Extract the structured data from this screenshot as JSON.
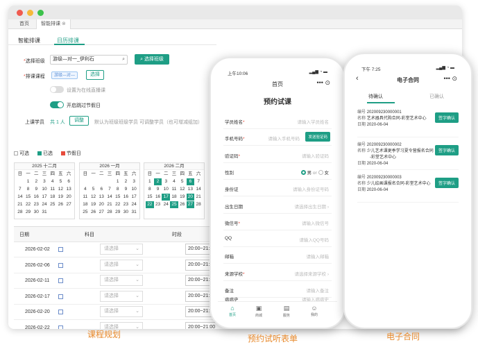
{
  "window": {
    "tabs": [
      "首页",
      "智能排课"
    ],
    "tab_close": "⊗",
    "subtabs": [
      "智能排课",
      "日历排课"
    ]
  },
  "form": {
    "class_label": "选择班级",
    "class_value": "游级—对一_伊利石",
    "class_btn": "选择班级",
    "course_label": "排课课程",
    "course_tag": "游级—对—",
    "course_btn": "选择",
    "toggle1": "设置为在线直播课",
    "toggle2": "开启跳过节假日",
    "students_label": "上课学员",
    "students_count": "共 1 人",
    "students_btn": "调整",
    "students_note": "默认为班级班级学员  可调整学员（也可增减组加）"
  },
  "legend": {
    "free": "可选",
    "selected": "已选",
    "holiday": "节假日"
  },
  "colors": {
    "accent": "#1e9e85",
    "caption": "#e8892b",
    "holiday": "#e74c3c"
  },
  "calendars": [
    {
      "title": "2025 十二月",
      "weekdays": [
        "日",
        "一",
        "二",
        "三",
        "四",
        "五",
        "六"
      ],
      "cells": [
        "",
        "1",
        "2",
        "3",
        "4",
        "5",
        "6",
        "7",
        "8",
        "9",
        "10",
        "11",
        "12",
        "13",
        "14",
        "15",
        "16",
        "17",
        "18",
        "19",
        "20",
        "21",
        "22",
        "23",
        "24",
        "25",
        "26",
        "27",
        "28",
        "29",
        "30",
        "31",
        "",
        "",
        ""
      ],
      "highlighted": []
    },
    {
      "title": "2026 一月",
      "weekdays": [
        "日",
        "一",
        "二",
        "三",
        "四",
        "五",
        "六"
      ],
      "cells": [
        "",
        "",
        "",
        "",
        "1",
        "2",
        "3",
        "4",
        "5",
        "6",
        "7",
        "8",
        "9",
        "10",
        "11",
        "12",
        "13",
        "14",
        "15",
        "16",
        "17",
        "18",
        "19",
        "20",
        "21",
        "22",
        "23",
        "24",
        "25",
        "26",
        "27",
        "28",
        "29",
        "30",
        "31"
      ],
      "highlighted": []
    },
    {
      "title": "2026 二月",
      "weekdays": [
        "日",
        "一",
        "二",
        "三",
        "四",
        "五",
        "六"
      ],
      "cells": [
        "1",
        "2",
        "3",
        "4",
        "5",
        "6",
        "7",
        "8",
        "9",
        "10",
        "11",
        "12",
        "13",
        "14",
        "15",
        "16",
        "17",
        "18",
        "19",
        "20",
        "21",
        "22",
        "23",
        "24",
        "25",
        "26",
        "27",
        "28",
        "",
        "",
        "",
        "",
        "",
        "",
        ""
      ],
      "highlighted": [
        "2",
        "6",
        "17",
        "20",
        "22",
        "25",
        "27"
      ]
    }
  ],
  "table": {
    "headers": [
      "日期",
      "科目",
      "时段"
    ],
    "select_placeholder": "请选择",
    "rows": [
      {
        "date": "2026-02-02",
        "time": "20:00~21:00"
      },
      {
        "date": "2026-02-06",
        "time": "20:00~21:00"
      },
      {
        "date": "2026-02-11",
        "time": "20:00~21:00"
      },
      {
        "date": "2026-02-17",
        "time": "20:00~21:00"
      },
      {
        "date": "2026-02-20",
        "time": "20:00~21:00"
      },
      {
        "date": "2026-02-22",
        "time": "20:00~21:00"
      }
    ]
  },
  "phone1": {
    "time": "上午10:06",
    "signal": "▂▄▆ ◔ ▬",
    "nav_title": "首页",
    "menu": "•••  ⊙",
    "form_title": "预约试课",
    "fields": [
      {
        "label": "学员姓名",
        "req": true,
        "placeholder": "请输入学员姓名"
      },
      {
        "label": "手机号码",
        "req": true,
        "placeholder": "请输入手机号码",
        "button": "发送验证码"
      },
      {
        "label": "验证码",
        "req": true,
        "placeholder": "请输入验证码"
      },
      {
        "label": "性别",
        "req": false,
        "radio": [
          "男",
          "女"
        ],
        "or": "or"
      },
      {
        "label": "身份证",
        "req": false,
        "placeholder": "请输入身份证号码"
      },
      {
        "label": "出生日期",
        "req": false,
        "placeholder": "请选择出生日期  ›"
      },
      {
        "label": "微信号",
        "req": true,
        "placeholder": "请输入微信号"
      },
      {
        "label": "QQ",
        "req": false,
        "placeholder": "请输入QQ号码"
      },
      {
        "label": "邮箱",
        "req": false,
        "placeholder": "请输入邮箱"
      },
      {
        "label": "来源学校",
        "req": true,
        "placeholder": "请选择来源学校  ›"
      },
      {
        "label": "备注",
        "req": false,
        "placeholder": "请输入备注"
      },
      {
        "label": "病病史",
        "req": false,
        "placeholder": "请输入病病史"
      }
    ],
    "bottom_nav": [
      "首页",
      "商城",
      "服务",
      "我的"
    ]
  },
  "phone2": {
    "time": "下午 7:25",
    "signal": "▂▄▆ ◔ ▬",
    "back": "‹",
    "nav_title": "电子合同",
    "menu": "•••  ⊙",
    "tabs": [
      "待确认",
      "已确认"
    ],
    "sign_btn": "签字确认",
    "contracts": [
      {
        "no_label": "编号",
        "no": "202009230000001",
        "name_label": "名称",
        "name": "艺术器具代购合同-彩堂艺术中心",
        "date_label": "日期",
        "date": "2020-06-04"
      },
      {
        "no_label": "编号",
        "no": "202009230000002",
        "name_label": "名称",
        "name": "少儿艺术课更季学习夏令营报名合同",
        "name2": "-彩堂艺术中心",
        "date_label": "日期",
        "date": "2020-06-04"
      },
      {
        "no_label": "编号",
        "no": "202009230000003",
        "name_label": "名称",
        "name": "少儿绘画课报名合同-彩堂艺术中心",
        "date_label": "日期",
        "date": "2020-06-04"
      }
    ]
  },
  "captions": [
    "课程规划",
    "预约试听表单",
    "电子合同"
  ]
}
